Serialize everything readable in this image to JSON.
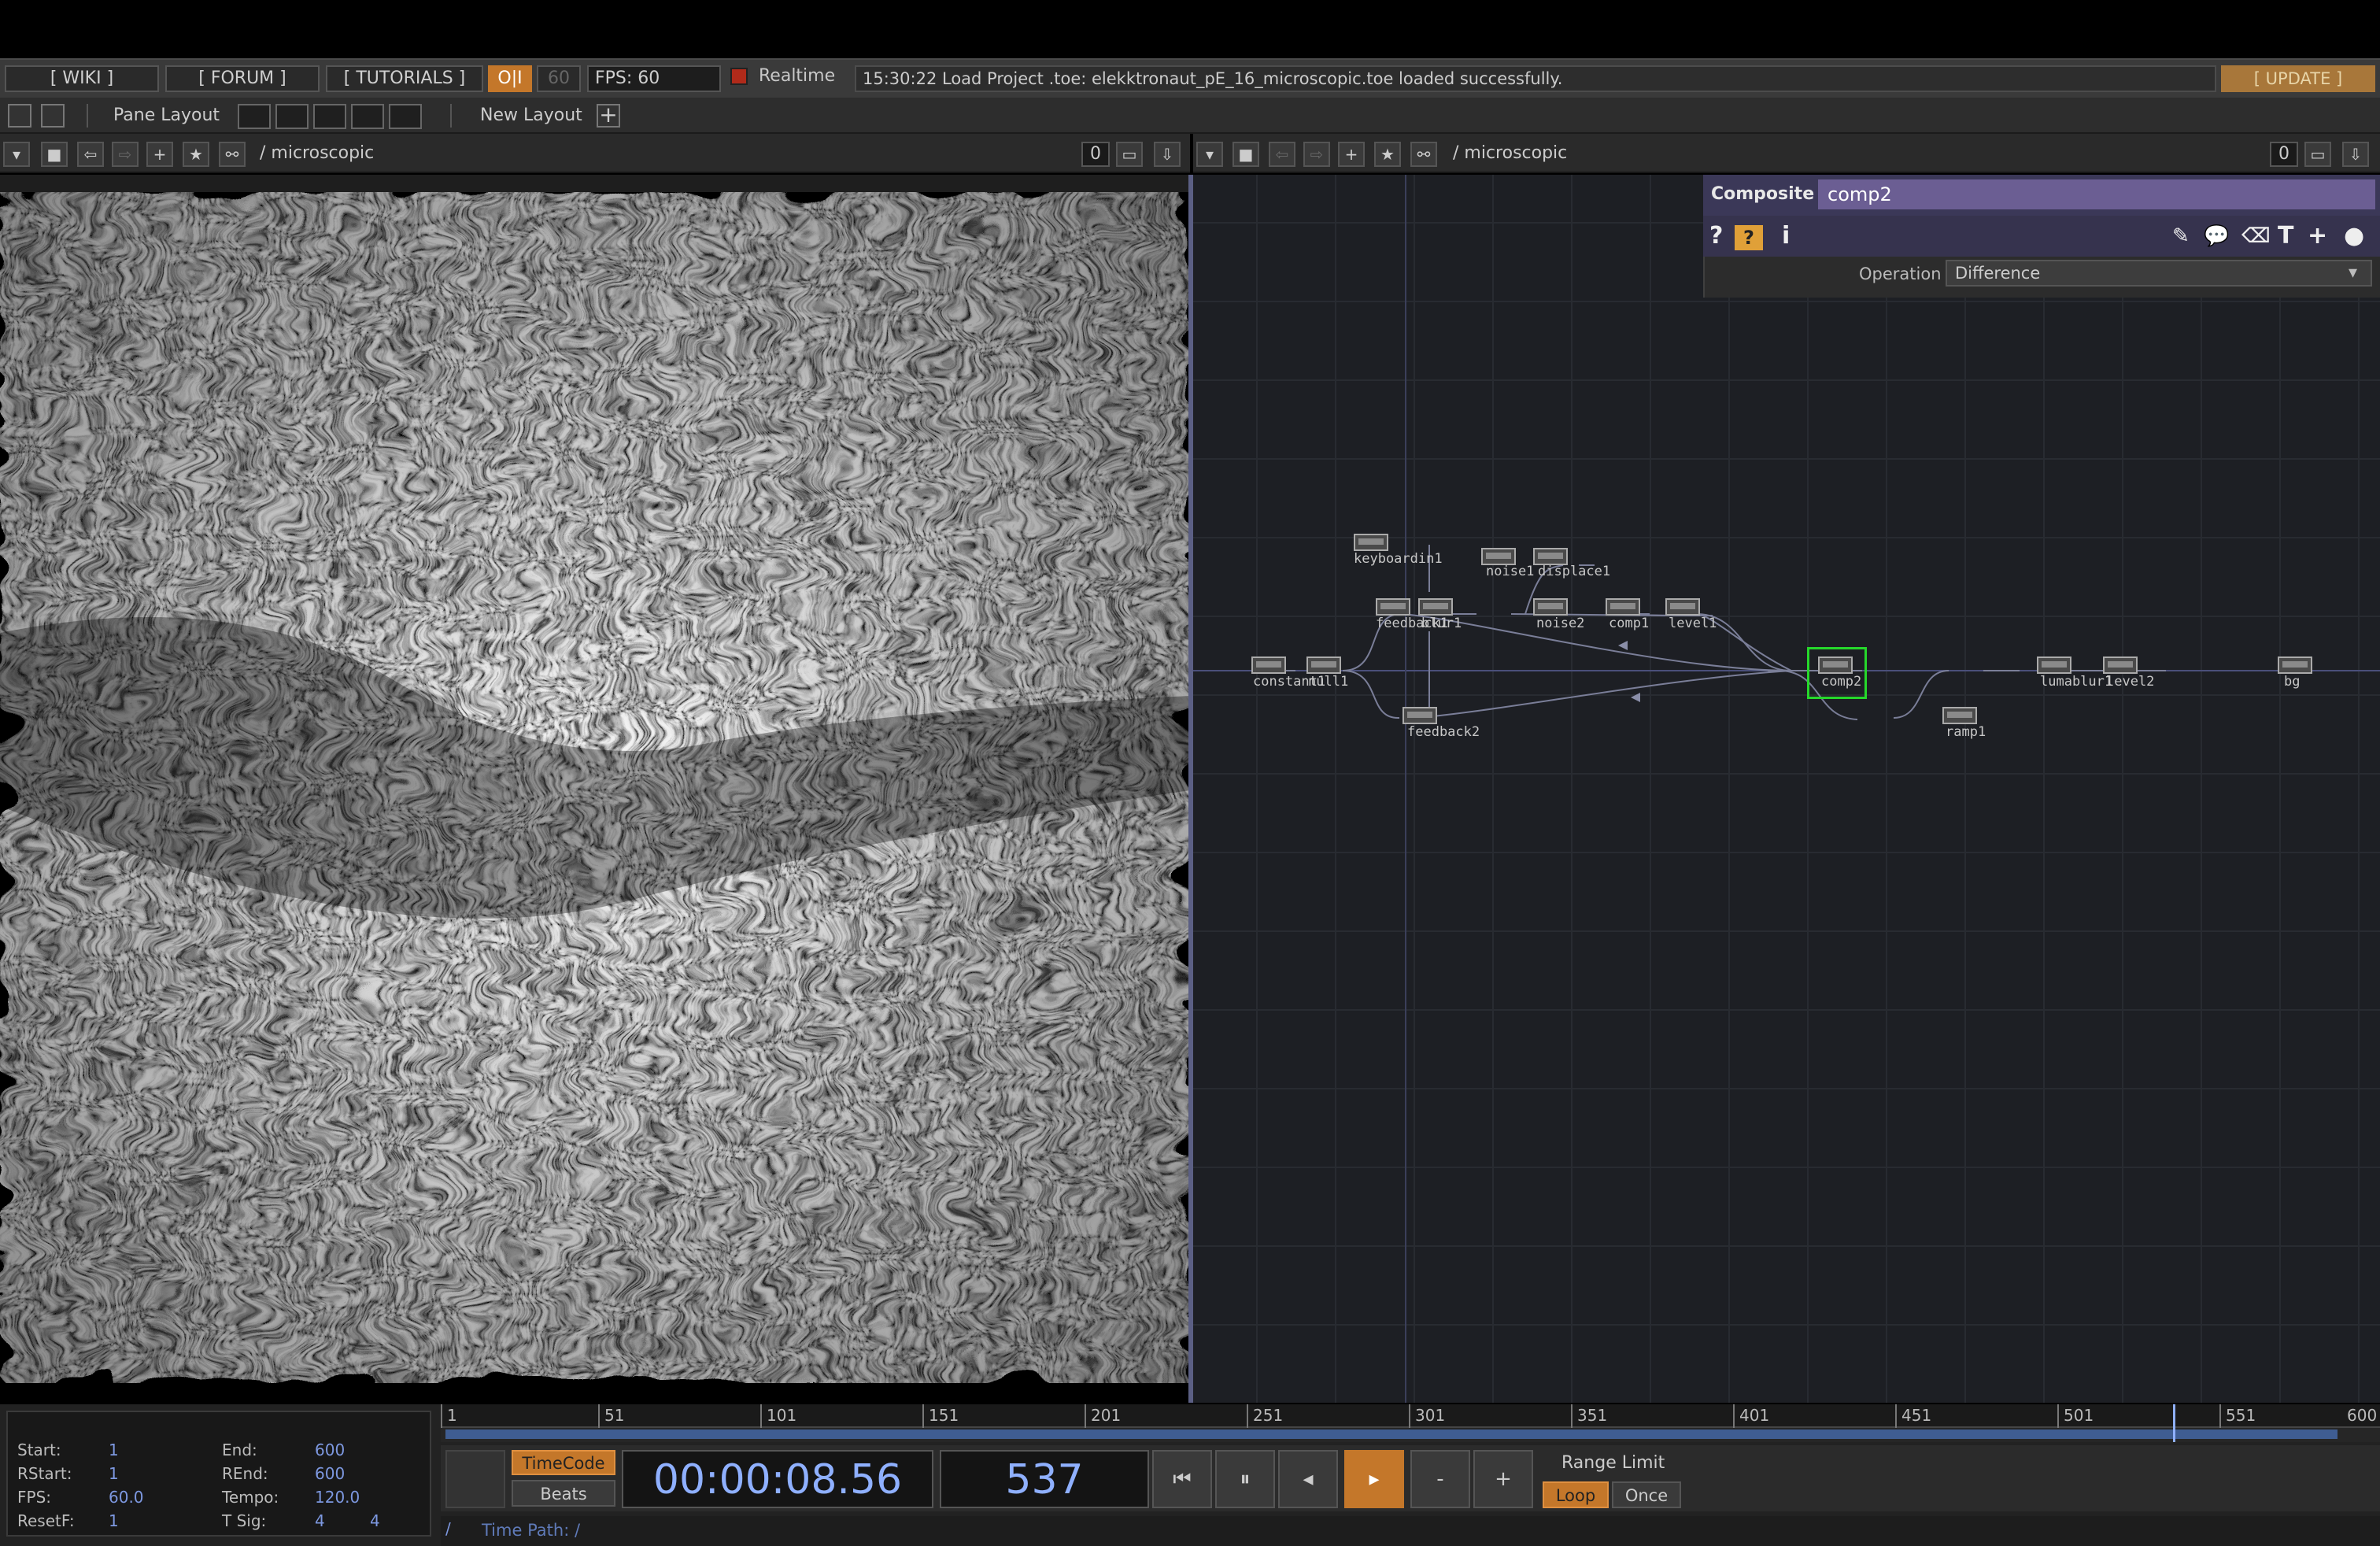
{
  "topbar": {
    "wiki": "[ WIKI ]",
    "forum": "[ FORUM ]",
    "tutorials": "[ TUTORIALS ]",
    "oi": "O|I",
    "sixty": "60",
    "fps_label": "FPS:  60",
    "realtime": "Realtime",
    "status": "15:30:22 Load Project .toe: elekktronaut_pE_16_microscopic.toe loaded successfully.",
    "update": "[ UPDATE ]"
  },
  "layoutbar": {
    "pane_layout": "Pane Layout",
    "new_layout": "New Layout"
  },
  "left_pane": {
    "path": "/ microscopic",
    "zero": "0"
  },
  "right_pane": {
    "path": "/ microscopic",
    "zero": "0"
  },
  "params": {
    "type": "Composite",
    "name": "comp2",
    "operation_label": "Operation",
    "operation_value": "Difference"
  },
  "nodes": [
    {
      "label": "keyboardin1"
    },
    {
      "label": "noise1"
    },
    {
      "label": "displace1"
    },
    {
      "label": "feedback1"
    },
    {
      "label": "blur1"
    },
    {
      "label": "noise2"
    },
    {
      "label": "comp1"
    },
    {
      "label": "level1"
    },
    {
      "label": "constant1"
    },
    {
      "label": "null1"
    },
    {
      "label": "feedback2"
    },
    {
      "label": "comp2"
    },
    {
      "label": "ramp1"
    },
    {
      "label": "lumablur1"
    },
    {
      "label": "level2"
    },
    {
      "label": "bg"
    }
  ],
  "timeline": {
    "start_label": "Start:",
    "start": "1",
    "end_label": "End:",
    "end": "600",
    "rstart_label": "RStart:",
    "rstart": "1",
    "rend_label": "REnd:",
    "rend": "600",
    "fps_label": "FPS:",
    "fps": "60.0",
    "tempo_label": "Tempo:",
    "tempo": "120.0",
    "resetf_label": "ResetF:",
    "resetf": "1",
    "tsig_label": "T Sig:",
    "tsig_a": "4",
    "tsig_b": "4",
    "ticks": [
      "1",
      "51",
      "101",
      "151",
      "201",
      "251",
      "301",
      "351",
      "401",
      "451",
      "501",
      "551",
      "600"
    ],
    "timecode_btn": "TimeCode",
    "beats_btn": "Beats",
    "timecode": "00:00:08.56",
    "frame": "537",
    "range_limit": "Range Limit",
    "loop": "Loop",
    "once": "Once",
    "time_path_slash": "/",
    "time_path": "Time Path: /",
    "current_frame": 537,
    "range_end": 600
  }
}
